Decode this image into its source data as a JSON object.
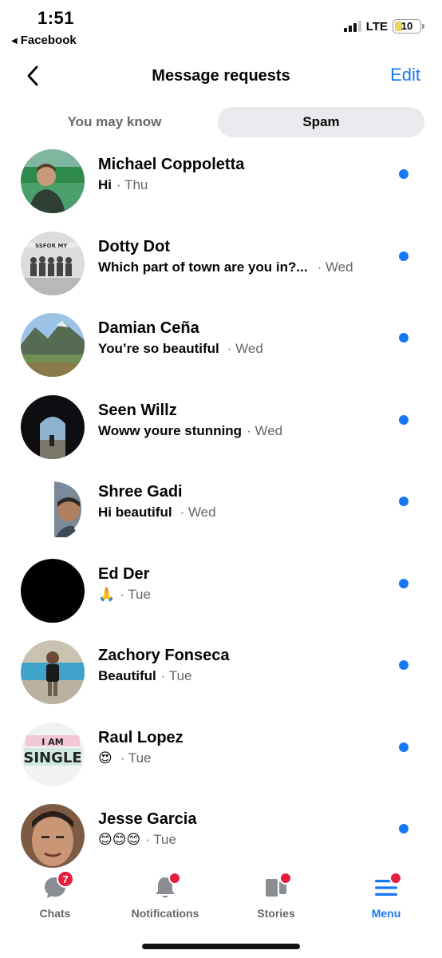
{
  "status_bar": {
    "time": "1:51",
    "back_app": "Facebook",
    "network": "LTE",
    "battery": "10"
  },
  "header": {
    "title": "Message requests",
    "edit_label": "Edit"
  },
  "tabs": [
    {
      "label": "You may know",
      "active": false
    },
    {
      "label": "Spam",
      "active": true
    }
  ],
  "requests": [
    {
      "name": "Michael Coppoletta",
      "message": "Hi",
      "time": "· Thu",
      "unread": true
    },
    {
      "name": "Dotty Dot",
      "message": "Which part of town are you in?...",
      "time": "· Wed",
      "unread": true
    },
    {
      "name": "Damian Ceña",
      "message": "You’re so beautiful",
      "time": "· Wed",
      "unread": true
    },
    {
      "name": "Seen Willz",
      "message": "Woww youre stunning",
      "time": "· Wed",
      "unread": true
    },
    {
      "name": "Shree Gadi",
      "message": "Hi beautiful",
      "time": "· Wed",
      "unread": true
    },
    {
      "name": "Ed Der",
      "message": "🙏",
      "time": "· Tue",
      "unread": true
    },
    {
      "name": "Zachory Fonseca",
      "message": "Beautiful",
      "time": "· Tue",
      "unread": true
    },
    {
      "name": "Raul Lopez",
      "message": "😍",
      "time": "· Tue",
      "unread": true
    },
    {
      "name": "Jesse Garcia",
      "message": "😊😊😊",
      "time": "· Tue",
      "unread": true
    }
  ],
  "avatar_texts": {
    "dotty_banner": "SSFOR MY",
    "raul_line1": "I AM",
    "raul_line2": "SINGLE"
  },
  "bottom_nav": {
    "chats": {
      "label": "Chats",
      "badge": "7",
      "icon": "chat-bubble-icon"
    },
    "notifications": {
      "label": "Notifications",
      "icon": "bell-icon"
    },
    "stories": {
      "label": "Stories",
      "icon": "stories-icon"
    },
    "menu": {
      "label": "Menu",
      "icon": "hamburger-menu-icon",
      "active": true
    }
  },
  "colors": {
    "accent": "#1877f2",
    "badge": "#e41e3f",
    "secondary_text": "#65676b",
    "active_tab_bg": "#e9eaed"
  }
}
